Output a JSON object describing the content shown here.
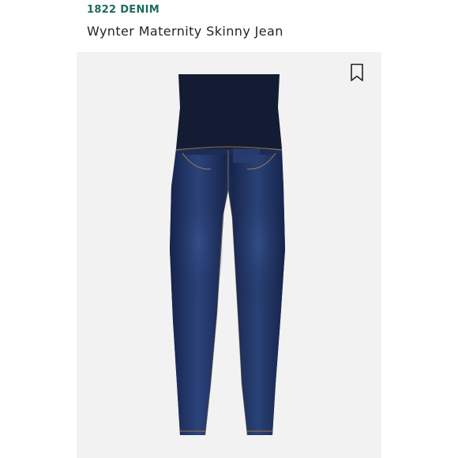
{
  "product": {
    "brand": "1822 DENIM",
    "name": "Wynter Maternity Skinny Jean"
  },
  "image": {
    "subject": "maternity skinny jean with navy full-panel waistband",
    "panel_color": "#f2f2f2",
    "denim_color": "#1c2c55",
    "waistband_color": "#141c34",
    "stitch_color": "#b98a4a"
  },
  "actions": {
    "save_icon": "bookmark-icon"
  }
}
